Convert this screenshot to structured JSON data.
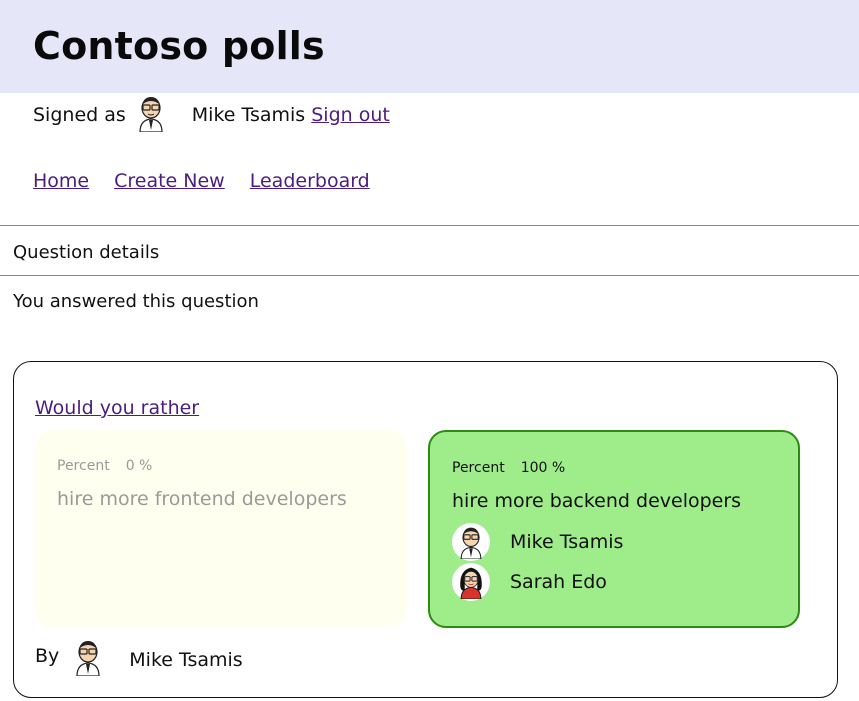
{
  "header": {
    "title": "Contoso polls"
  },
  "user": {
    "signed_label": "Signed as",
    "name": "Mike Tsamis",
    "sign_out": "Sign out"
  },
  "nav": {
    "home": "Home",
    "create": "Create New",
    "leaderboard": "Leaderboard"
  },
  "page": {
    "section_title": "Question details",
    "status": "You answered this question"
  },
  "question": {
    "link": "Would you rather",
    "option_a": {
      "pct_label": "Percent",
      "pct_value": "0 %",
      "text": "hire more frontend developers"
    },
    "option_b": {
      "pct_label": "Percent",
      "pct_value": "100 %",
      "text": "hire more backend developers",
      "voters": [
        "Mike Tsamis",
        "Sarah Edo"
      ]
    },
    "by_label": "By",
    "author": "Mike Tsamis"
  },
  "colors": {
    "header_bg": "#e6e6f9",
    "selected_bg": "#9fec8b",
    "selected_border": "#2d8a12",
    "unselected_bg": "#fffff0",
    "link": "#4b1d7e"
  }
}
